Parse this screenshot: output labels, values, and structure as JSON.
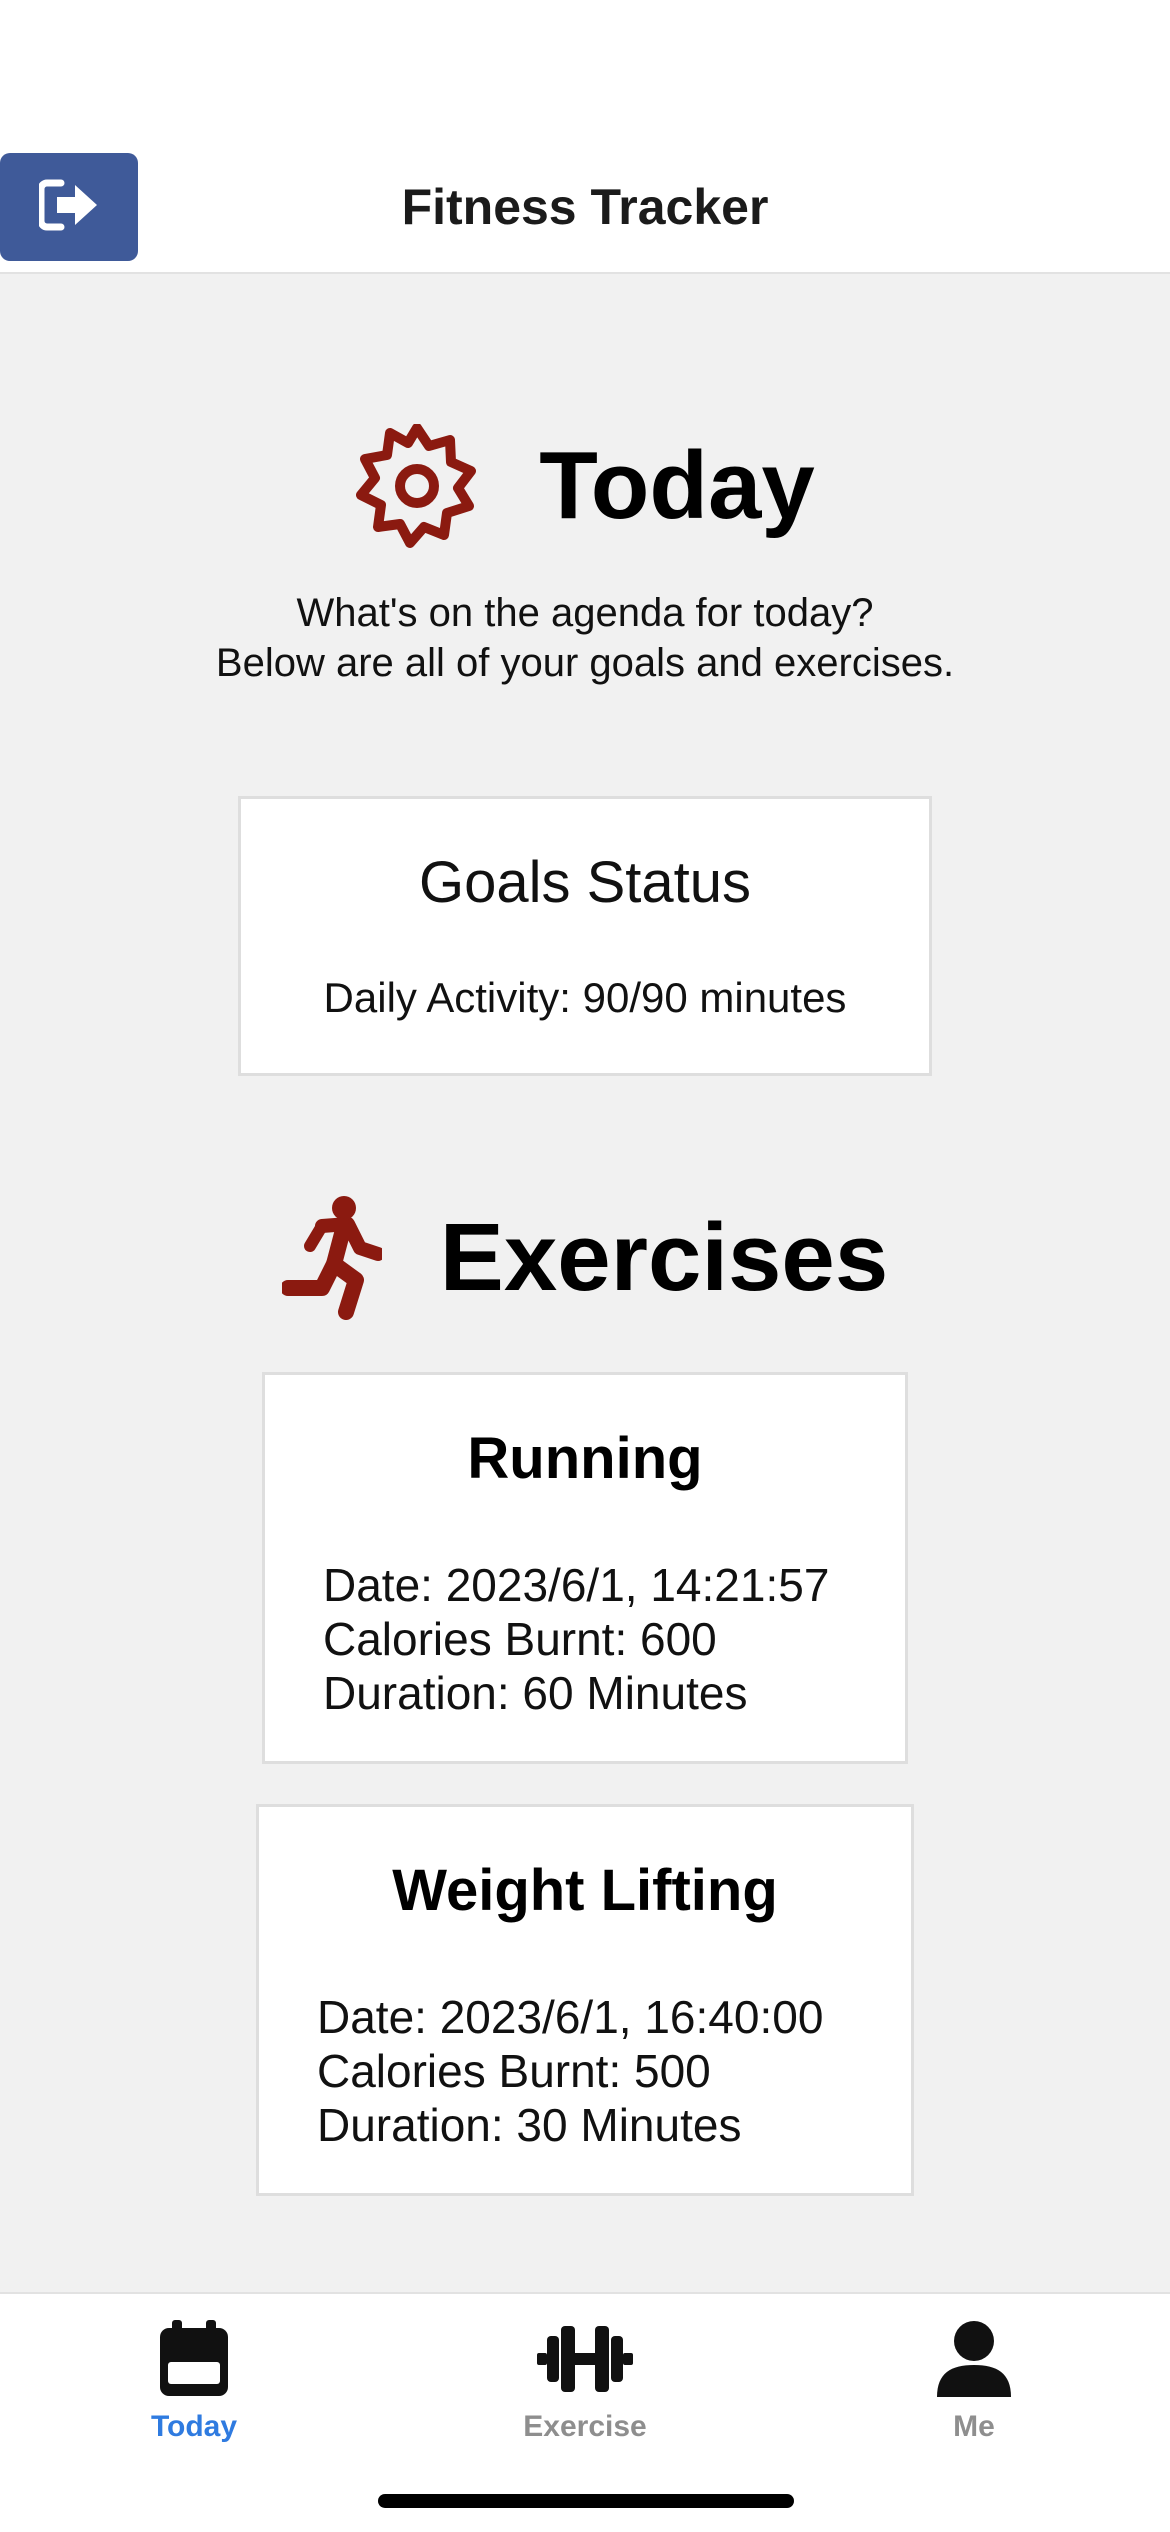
{
  "header": {
    "title": "Fitness Tracker",
    "logout_icon": "sign-out-icon"
  },
  "today": {
    "heading": "Today",
    "icon": "gear-icon",
    "intro_line1": "What's on the agenda for today?",
    "intro_line2": "Below are all of your goals and exercises."
  },
  "goals": {
    "title": "Goals Status",
    "daily_activity": "Daily Activity: 90/90 minutes"
  },
  "exercises": {
    "heading": "Exercises",
    "icon": "running-person-icon",
    "items": [
      {
        "name": "Running",
        "date": "Date: 2023/6/1, 14:21:57",
        "calories": "Calories Burnt: 600",
        "duration": "Duration: 60 Minutes"
      },
      {
        "name": "Weight Lifting",
        "date": "Date: 2023/6/1, 16:40:00",
        "calories": "Calories Burnt: 500",
        "duration": "Duration: 30 Minutes"
      }
    ]
  },
  "tabs": [
    {
      "label": "Today",
      "icon": "calendar-icon",
      "active": true
    },
    {
      "label": "Exercise",
      "icon": "dumbbell-icon",
      "active": false
    },
    {
      "label": "Me",
      "icon": "user-icon",
      "active": false
    }
  ],
  "colors": {
    "accent_red": "#8b1a10",
    "logout_button": "#3f5a99",
    "tab_active": "#2f7be0",
    "tab_inactive": "#8e8e8e"
  }
}
